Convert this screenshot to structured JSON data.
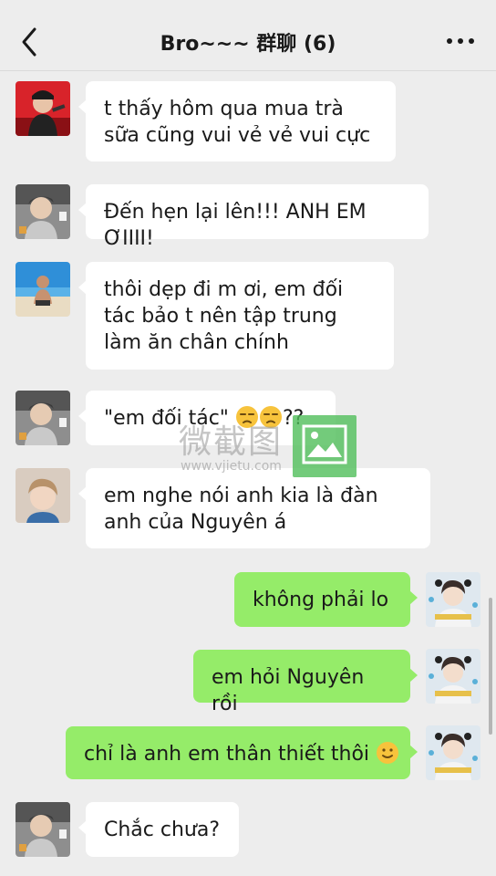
{
  "header": {
    "title": "Bro~~~ 群聊 (6)",
    "back_icon": "chevron-left-icon",
    "more_icon": "more-dots-icon"
  },
  "messages": [
    {
      "side": "in",
      "avatar": "avatar-user-red",
      "text": "t thấy hôm qua mua trà sữa cũng vui vẻ vẻ vui cực"
    },
    {
      "side": "in",
      "avatar": "avatar-user-grey",
      "text": "Đến hẹn lại lên!!! ANH EM ƠIIII!"
    },
    {
      "side": "in",
      "avatar": "avatar-user-beach",
      "text": "thôi dẹp đi m ơi, em đối tác bảo t nên tập trung làm ăn chân chính"
    },
    {
      "side": "in",
      "avatar": "avatar-user-grey",
      "text_before": "\"em đối tác\" ",
      "emojis": [
        "unamused-emoji",
        "unamused-emoji"
      ],
      "text_after": "??"
    },
    {
      "side": "in",
      "avatar": "avatar-user-blond",
      "text": "em nghe nói anh kia là đàn anh của Nguyên á"
    },
    {
      "side": "out",
      "avatar": "avatar-self",
      "text": "không phải lo"
    },
    {
      "side": "out",
      "avatar": "avatar-self",
      "text": "em hỏi Nguyên rồi"
    },
    {
      "side": "out",
      "avatar": "avatar-self",
      "text": "chỉ là anh em thân thiết thôi ",
      "emojis": [
        "slightly-smiling-emoji"
      ]
    },
    {
      "side": "in",
      "avatar": "avatar-user-grey",
      "text": "Chắc chưa?"
    }
  ],
  "watermark": {
    "text": "微截图",
    "url": "www.vjietu.com"
  },
  "colors": {
    "background": "#ededed",
    "bubble_in": "#ffffff",
    "bubble_out": "#95ec69",
    "text": "#1a1a1a"
  }
}
